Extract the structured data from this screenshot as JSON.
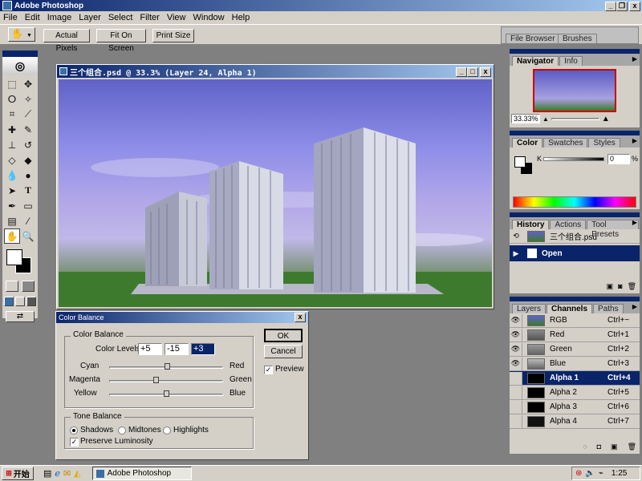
{
  "app": {
    "title": "Adobe Photoshop"
  },
  "menu": [
    "File",
    "Edit",
    "Image",
    "Layer",
    "Select",
    "Filter",
    "View",
    "Window",
    "Help"
  ],
  "options": {
    "actual_pixels": "Actual Pixels",
    "fit_on_screen": "Fit On Screen",
    "print_size": "Print Size",
    "file_browser": "File Browser",
    "brushes": "Brushes"
  },
  "doc": {
    "title": "三个组合.psd @ 33.3% (Layer 24, Alpha 1)"
  },
  "navigator": {
    "tabs": [
      "Navigator",
      "Info"
    ],
    "zoom": "33.33%"
  },
  "color_panel": {
    "tabs": [
      "Color",
      "Swatches",
      "Styles"
    ],
    "channel": "K",
    "value": "0",
    "unit": "%"
  },
  "history": {
    "tabs": [
      "History",
      "Actions",
      "Tool Presets"
    ],
    "snapshot": "三个组合.psd",
    "step": "Open"
  },
  "channels": {
    "tabs": [
      "Layers",
      "Channels",
      "Paths"
    ],
    "rows": [
      {
        "name": "RGB",
        "shortcut": "Ctrl+~",
        "visible": true
      },
      {
        "name": "Red",
        "shortcut": "Ctrl+1",
        "visible": true
      },
      {
        "name": "Green",
        "shortcut": "Ctrl+2",
        "visible": true
      },
      {
        "name": "Blue",
        "shortcut": "Ctrl+3",
        "visible": true
      },
      {
        "name": "Alpha 1",
        "shortcut": "Ctrl+4",
        "visible": false,
        "selected": true
      },
      {
        "name": "Alpha 2",
        "shortcut": "Ctrl+5",
        "visible": false
      },
      {
        "name": "Alpha 3",
        "shortcut": "Ctrl+6",
        "visible": false
      },
      {
        "name": "Alpha 4",
        "shortcut": "Ctrl+7",
        "visible": false
      }
    ]
  },
  "dialog": {
    "title": "Color Balance",
    "group1": "Color Balance",
    "levels_label": "Color Levels:",
    "levels": [
      "+5",
      "-15",
      "+3"
    ],
    "sliders": [
      {
        "left": "Cyan",
        "right": "Red",
        "value": 5
      },
      {
        "left": "Magenta",
        "right": "Green",
        "value": -15
      },
      {
        "left": "Yellow",
        "right": "Blue",
        "value": 3
      }
    ],
    "ok": "OK",
    "cancel": "Cancel",
    "preview": "Preview",
    "group2": "Tone Balance",
    "shadows": "Shadows",
    "midtones": "Midtones",
    "highlights": "Highlights",
    "preserve": "Preserve Luminosity"
  },
  "taskbar": {
    "start": "开始",
    "task": "Adobe Photoshop",
    "time": "1:25"
  }
}
